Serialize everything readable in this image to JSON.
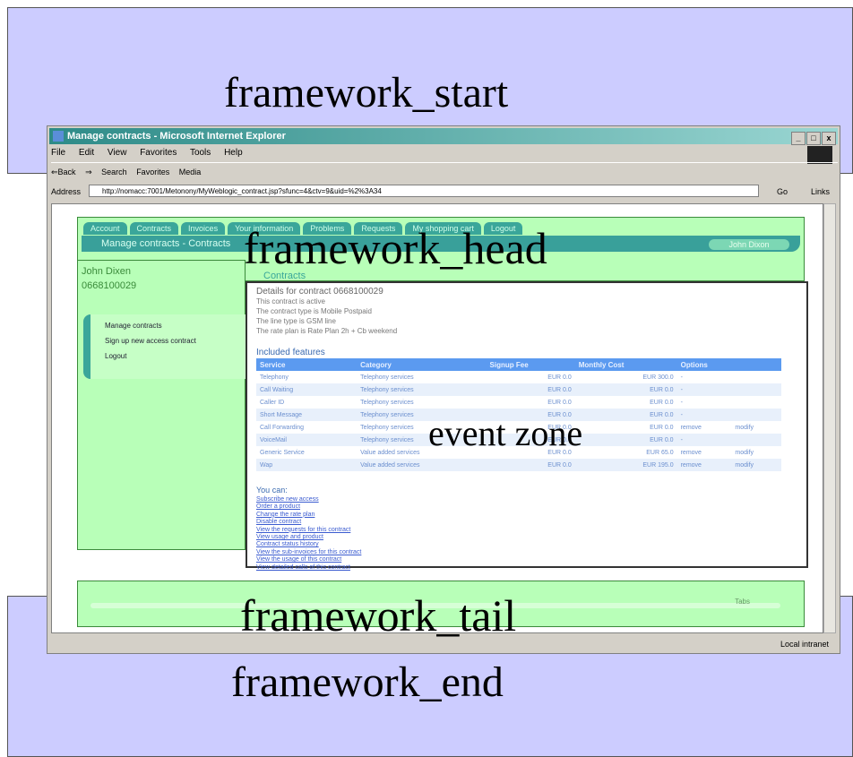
{
  "labels": {
    "framework_start": "framework_start",
    "framework_head": "framework_head",
    "event_zone": "event zone",
    "framework_tail": "framework_tail",
    "framework_end": "framework_end"
  },
  "browser": {
    "title": "Manage contracts - Microsoft Internet Explorer",
    "window_buttons": [
      "_",
      "□",
      "x"
    ],
    "menu": [
      "File",
      "Edit",
      "View",
      "Favorites",
      "Tools",
      "Help"
    ],
    "toolbar": [
      "⇐Back",
      "⇒",
      "Search",
      "Favorites",
      "Media"
    ],
    "address_label": "Address",
    "address_url": "http://nomacc:7001/Metonony/MyWeblogic_contract.jsp?sfunc=4&ctv=9&uid=%2%3A34",
    "go_label": "Go",
    "links_label": "Links",
    "status_zone": "Local intranet"
  },
  "page": {
    "tabs": [
      "Account",
      "Contracts",
      "Invoices",
      "Your information",
      "Problems",
      "Requests",
      "My shopping cart",
      "Logout"
    ],
    "header_title": "Manage contracts - Contracts",
    "user_button": "John Dixon",
    "user_name": "John Dixen",
    "user_number": "0668100029",
    "side_menu": [
      "Manage contracts",
      "Sign up new access contract",
      "Logout"
    ],
    "section_title": "Contracts",
    "details_title": "Details for contract 0668100029",
    "details_lines": [
      "This contract is active",
      "The contract type is Mobile Postpaid",
      "The line type is GSM line",
      "The rate plan is Rate Plan 2h + Cb weekend"
    ],
    "features_title": "Included features",
    "table_headers": [
      "Service",
      "Category",
      "Signup Fee",
      "Monthly Cost",
      "Options"
    ],
    "table_rows": [
      [
        "Telephony",
        "Telephony services",
        "EUR 0.0",
        "EUR 300.0",
        "-",
        ""
      ],
      [
        "Call Waiting",
        "Telephony services",
        "EUR 0.0",
        "EUR 0.0",
        "-",
        ""
      ],
      [
        "Caller ID",
        "Telephony services",
        "EUR 0.0",
        "EUR 0.0",
        "-",
        ""
      ],
      [
        "Short Message",
        "Telephony services",
        "EUR 0.0",
        "EUR 0.0",
        "-",
        ""
      ],
      [
        "Call Forwarding",
        "Telephony services",
        "EUR 0.0",
        "EUR 0.0",
        "remove",
        "modify"
      ],
      [
        "VoiceMail",
        "Telephony services",
        "EUR 0.0",
        "EUR 0.0",
        "-",
        ""
      ],
      [
        "Generic Service",
        "Value added services",
        "EUR 0.0",
        "EUR 65.0",
        "remove",
        "modify"
      ],
      [
        "Wap",
        "Value added services",
        "EUR 0.0",
        "EUR 195.0",
        "remove",
        "modify"
      ]
    ],
    "you_can": "You can:",
    "actions": [
      "Subscribe new access",
      "Order a product",
      "Change the rate plan",
      "Disable contract",
      "View the requests for this contract",
      "View usage and product",
      "Contract status history",
      "View the sub-invoices for this contract",
      "View the usage of this contract",
      "View detailed calls of this contract"
    ],
    "tail_text": "Tabs"
  }
}
